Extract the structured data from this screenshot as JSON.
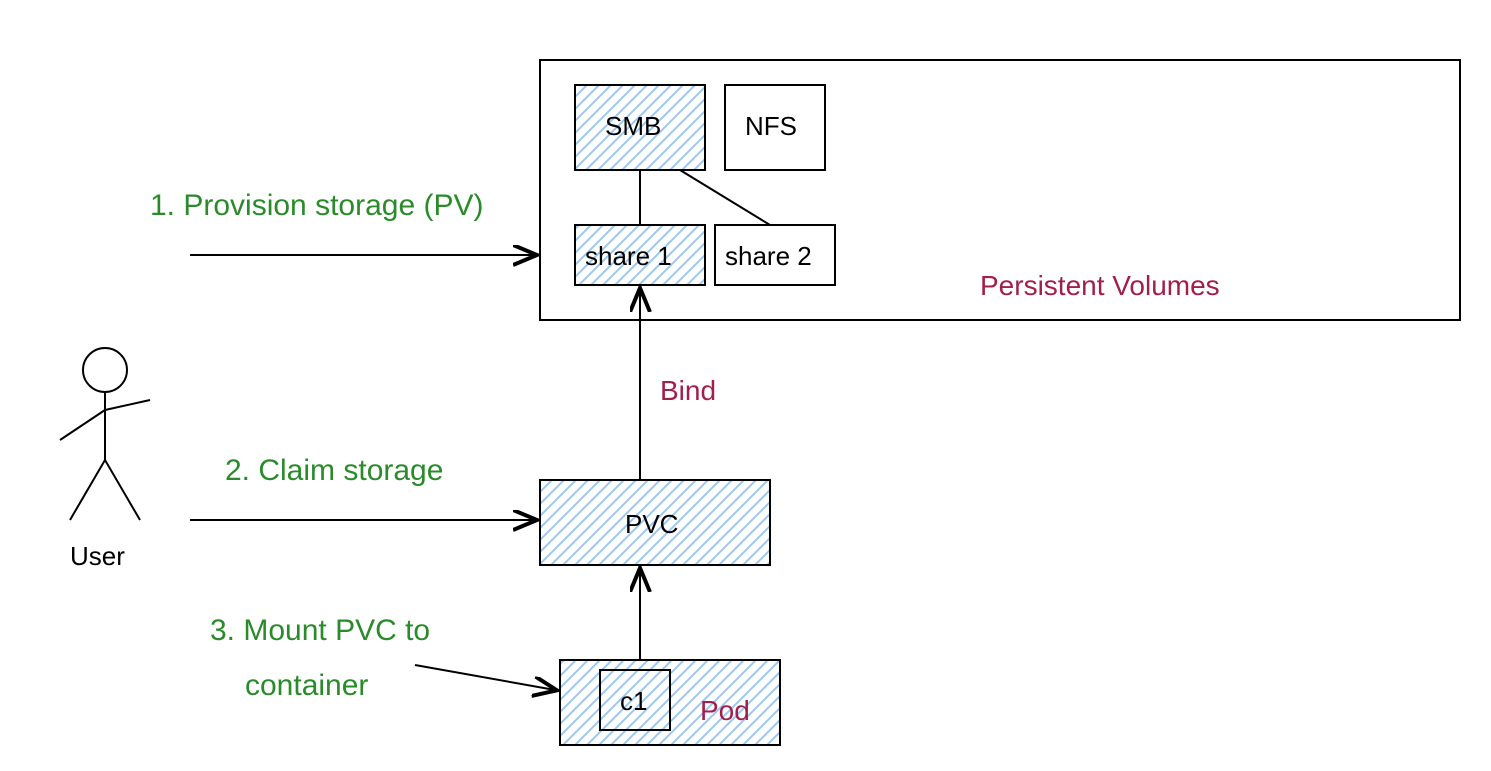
{
  "user_label": "User",
  "steps": {
    "s1": "1. Provision storage (PV)",
    "s2": "2. Claim storage",
    "s3_a": "3. Mount PVC to",
    "s3_b": "container"
  },
  "pv_container_label": "Persistent Volumes",
  "boxes": {
    "smb": "SMB",
    "nfs": "NFS",
    "share1": "share 1",
    "share2": "share 2",
    "pvc": "PVC",
    "c1": "c1",
    "pod": "Pod"
  },
  "bind_label": "Bind"
}
